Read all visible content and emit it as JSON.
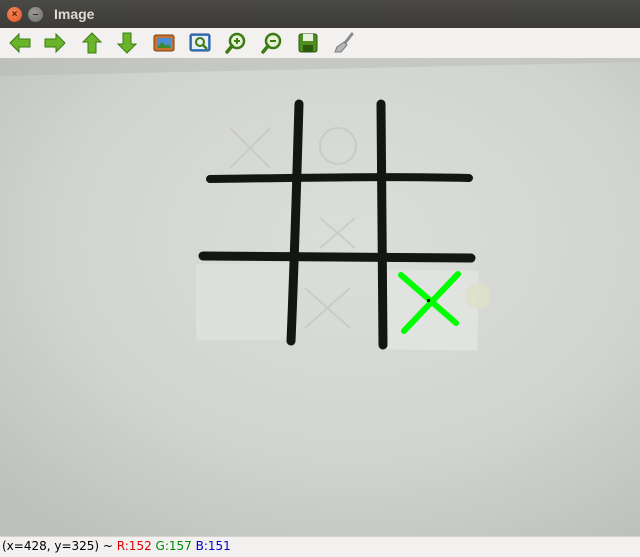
{
  "window": {
    "title": "Image",
    "close_symbol": "×",
    "minimize_symbol": "–"
  },
  "toolbar": {
    "buttons": [
      {
        "name": "pan-left-button",
        "icon": "arrow-left-icon"
      },
      {
        "name": "pan-right-button",
        "icon": "arrow-right-icon"
      },
      {
        "name": "pan-up-button",
        "icon": "arrow-up-icon"
      },
      {
        "name": "pan-down-button",
        "icon": "arrow-down-icon"
      },
      {
        "name": "zoom-fit-button",
        "icon": "picture-icon"
      },
      {
        "name": "zoom-region-button",
        "icon": "zoom-region-icon"
      },
      {
        "name": "zoom-in-button",
        "icon": "zoom-in-icon"
      },
      {
        "name": "zoom-out-button",
        "icon": "zoom-out-icon"
      },
      {
        "name": "save-button",
        "icon": "save-icon"
      },
      {
        "name": "properties-button",
        "icon": "brush-icon"
      }
    ]
  },
  "status": {
    "coords": "(x=428, y=325) ~ ",
    "r": "R:152",
    "g": "G:157",
    "b": "B:151"
  },
  "colors": {
    "marker": "#00ff00",
    "grid_ink": "#141614",
    "paper": "#d7d9d6"
  }
}
